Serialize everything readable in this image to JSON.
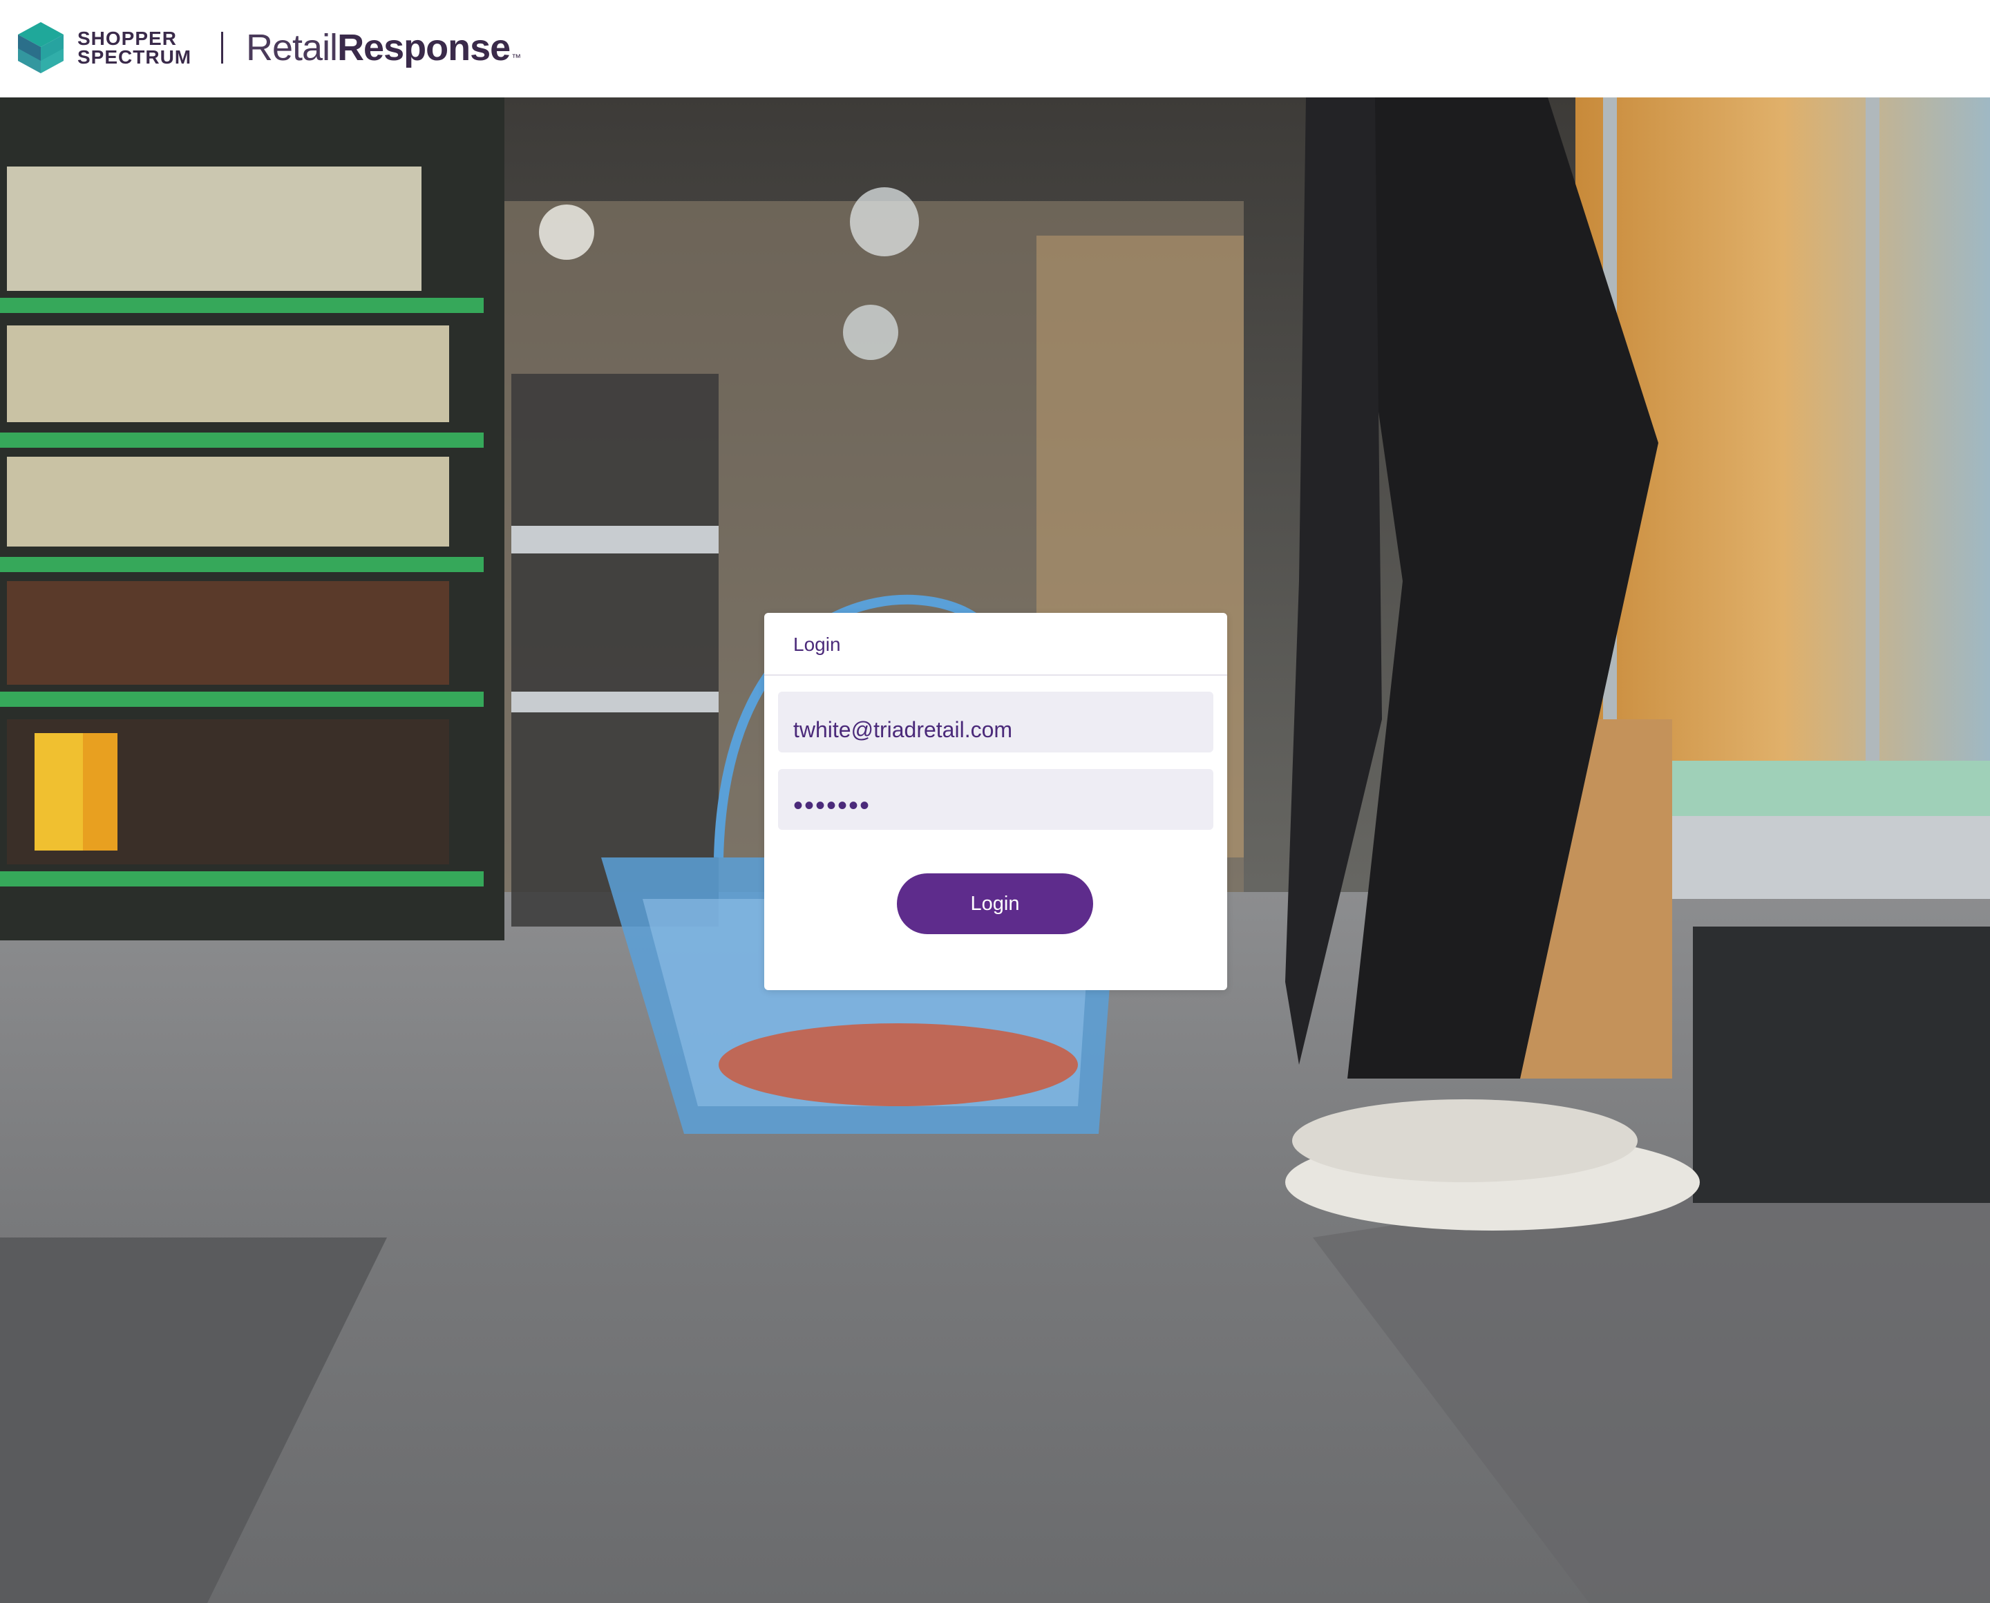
{
  "header": {
    "brand_line1": "SHOPPER",
    "brand_line2": "SPECTRUM",
    "product_light": "Retail",
    "product_bold": "Response",
    "product_tm": "™"
  },
  "login": {
    "title": "Login",
    "email_value": "twhite@triadretail.com",
    "password_value": "•••••••",
    "button_label": "Login"
  },
  "colors": {
    "accent": "#5e2c8c",
    "field_bg": "#eeedf4",
    "title_text": "#4b2a7a",
    "logo_teal": "#1fa89a",
    "logo_dark": "#2b6f8a"
  },
  "icons": {
    "logo": "shopper-spectrum-cube-icon"
  }
}
